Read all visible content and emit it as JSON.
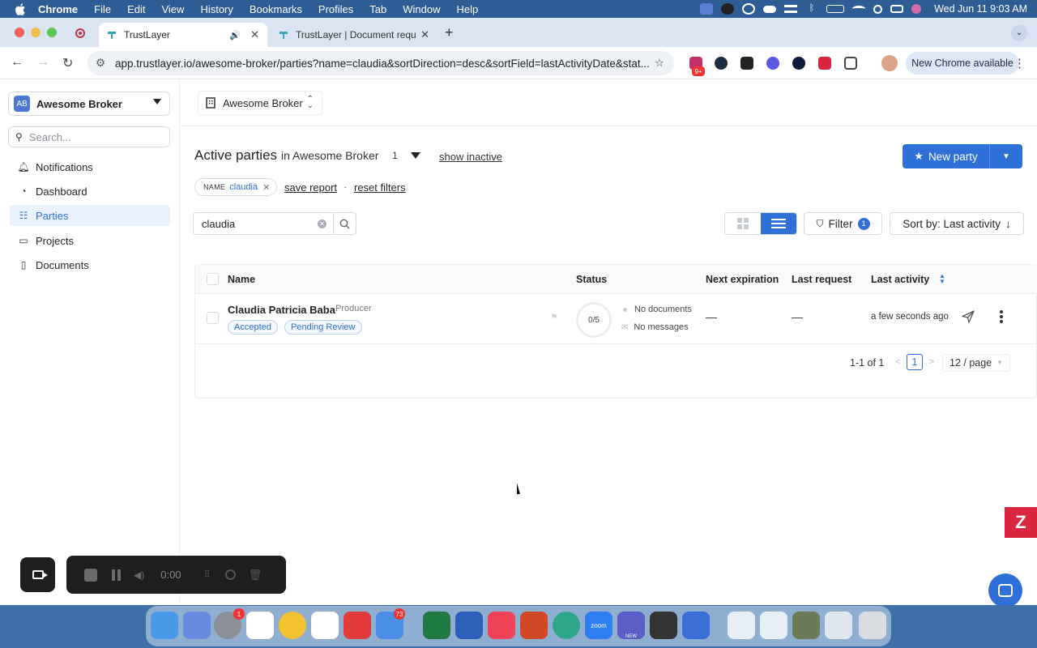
{
  "menubar": {
    "apple": "",
    "items": [
      "Chrome",
      "File",
      "Edit",
      "View",
      "History",
      "Bookmarks",
      "Profiles",
      "Tab",
      "Window",
      "Help"
    ],
    "clock": "Wed Jun 11  9:03 AM"
  },
  "browser": {
    "tabs": [
      {
        "label": "TrustLayer",
        "active": true
      },
      {
        "label": "TrustLayer | Document reque",
        "active": false
      }
    ],
    "url": "app.trustlayer.io/awesome-broker/parties?name=claudia&sortDirection=desc&sortField=lastActivityDate&stat...",
    "update_label": "New Chrome available",
    "extension_badge": "9+"
  },
  "sidebar": {
    "org_badge": "AB",
    "org_name": "Awesome Broker",
    "search_placeholder": "Search...",
    "nav": [
      {
        "label": "Notifications",
        "icon": "bell-icon"
      },
      {
        "label": "Dashboard",
        "icon": "dashboard-icon"
      },
      {
        "label": "Parties",
        "icon": "parties-icon",
        "active": true
      },
      {
        "label": "Projects",
        "icon": "projects-icon"
      },
      {
        "label": "Documents",
        "icon": "documents-icon"
      }
    ]
  },
  "topbar": {
    "org_select": "Awesome Broker"
  },
  "page": {
    "title": "Active parties",
    "subtitle": "in Awesome Broker",
    "count": "1",
    "show_inactive": "show inactive",
    "new_party": "New party",
    "filter_tag_key": "NAME",
    "filter_tag_value": "claudia",
    "save_report": "save report",
    "separator": "·",
    "reset_filters": "reset filters",
    "search_value": "claudia",
    "filter_label": "Filter",
    "filter_count": "1",
    "sort_label": "Sort by: Last activity"
  },
  "table": {
    "columns": {
      "name": "Name",
      "status": "Status",
      "next_expiration": "Next expiration",
      "last_request": "Last request",
      "last_activity": "Last activity"
    },
    "rows": [
      {
        "name": "Claudia Patricia Baba",
        "role": "Producer",
        "tags": [
          "Accepted",
          "Pending Review"
        ],
        "progress": "0/5",
        "documents": "No documents",
        "messages": "No messages",
        "next_expiration": "—",
        "last_request": "—",
        "last_activity": "a few seconds ago"
      }
    ],
    "pagination": {
      "range": "1-1 of 1",
      "current_page": "1",
      "page_size": "12 / page"
    }
  },
  "recorder": {
    "time": "0:00"
  },
  "dock": {
    "badges": {
      "slack": "1",
      "mail": "73"
    },
    "zoom_label": "zoom",
    "teams_label": "NEW"
  },
  "colors": {
    "accent": "#2e6fd8",
    "zendesk": "#d7263d"
  }
}
